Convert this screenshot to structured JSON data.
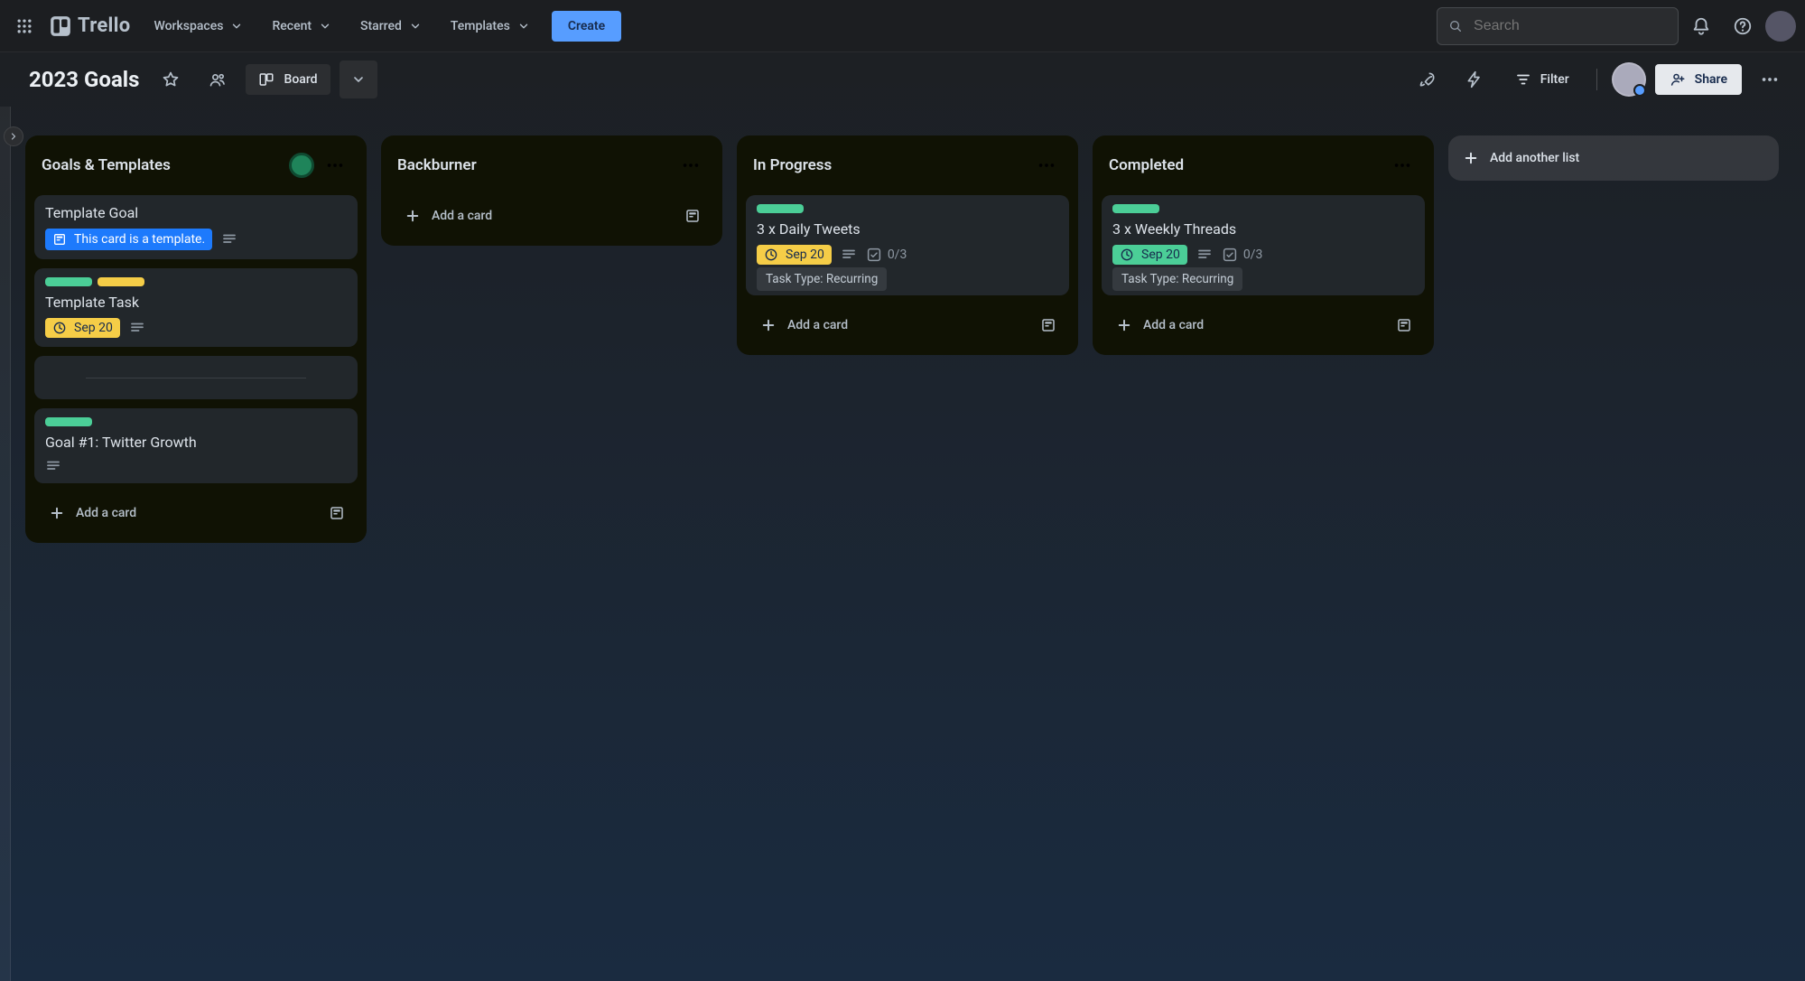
{
  "topbar": {
    "brand": "Trello",
    "nav": {
      "workspaces": "Workspaces",
      "recent": "Recent",
      "starred": "Starred",
      "templates": "Templates"
    },
    "create": "Create",
    "search_placeholder": "Search"
  },
  "boardbar": {
    "title": "2023 Goals",
    "view_label": "Board",
    "filter": "Filter",
    "share": "Share"
  },
  "add_list_label": "Add another list",
  "lists": [
    {
      "id": "goals",
      "title": "Goals & Templates",
      "has_badge": true,
      "add_card": "Add a card",
      "cards": [
        {
          "kind": "template-goal",
          "title": "Template Goal",
          "template_text": "This card is a template."
        },
        {
          "kind": "template-task",
          "labels": [
            "green",
            "yellow"
          ],
          "title": "Template Task",
          "due": {
            "text": "Sep 20",
            "class": "yellow"
          },
          "has_desc": true
        },
        {
          "kind": "separator"
        },
        {
          "kind": "goal",
          "labels": [
            "green"
          ],
          "title": "Goal #1: Twitter Growth",
          "has_desc": true
        }
      ]
    },
    {
      "id": "backburner",
      "title": "Backburner",
      "has_badge": false,
      "add_card": "Add a card",
      "cards": []
    },
    {
      "id": "inprogress",
      "title": "In Progress",
      "has_badge": false,
      "add_card": "Add a card",
      "cards": [
        {
          "kind": "task",
          "labels": [
            "green"
          ],
          "title": "3 x Daily Tweets",
          "due": {
            "text": "Sep 20",
            "class": "yellow"
          },
          "has_desc": true,
          "checklist": "0/3",
          "chip": "Task Type: Recurring"
        }
      ]
    },
    {
      "id": "completed",
      "title": "Completed",
      "has_badge": false,
      "add_card": "Add a card",
      "cards": [
        {
          "kind": "task",
          "labels": [
            "green"
          ],
          "title": "3 x Weekly Threads",
          "due": {
            "text": "Sep 20",
            "class": "green"
          },
          "has_desc": true,
          "checklist": "0/3",
          "chip": "Task Type: Recurring"
        }
      ]
    }
  ]
}
